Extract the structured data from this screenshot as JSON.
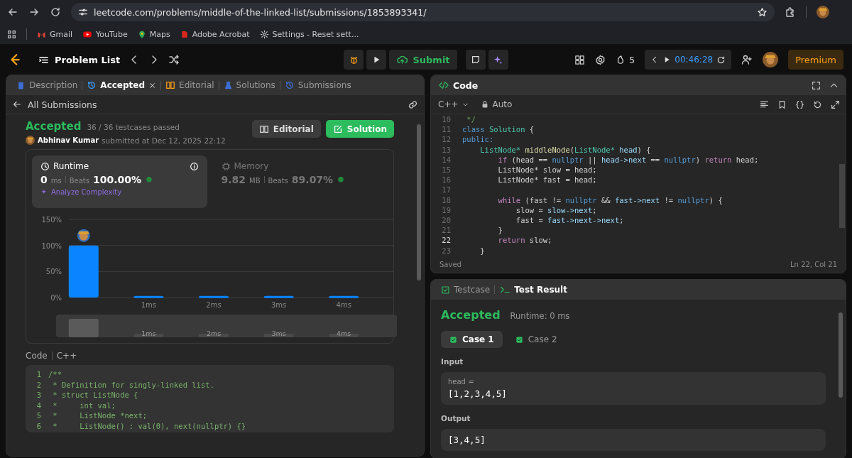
{
  "browser": {
    "url": "leetcode.com/problems/middle-of-the-linked-list/submissions/1853893341/",
    "bookmarks": [
      {
        "label": "Gmail",
        "kind": "gmail"
      },
      {
        "label": "YouTube",
        "kind": "youtube"
      },
      {
        "label": "Maps",
        "kind": "maps"
      },
      {
        "label": "Adobe Acrobat",
        "kind": "acrobat"
      },
      {
        "label": "Settings - Reset sett...",
        "kind": "settings"
      }
    ]
  },
  "nav": {
    "title": "Problem List",
    "submit": "Submit",
    "streak": "5",
    "timer": "00:46:28",
    "premium": "Premium"
  },
  "left_panel": {
    "tabs": [
      {
        "label": "Description",
        "kind": "description",
        "selected": false
      },
      {
        "label": "Accepted",
        "kind": "accepted",
        "selected": true
      },
      {
        "label": "Editorial",
        "kind": "editorial",
        "selected": false
      },
      {
        "label": "Solutions",
        "kind": "solutions",
        "selected": false
      },
      {
        "label": "Submissions",
        "kind": "submissions",
        "selected": false
      }
    ],
    "back_link": "All Submissions",
    "status": "Accepted",
    "testcases": "36 / 36 testcases passed",
    "author": "Abhinav Kumar",
    "submitted": "submitted at Dec 12, 2025 22:12",
    "buttons": [
      {
        "label": "Editorial",
        "kind": "editorial"
      },
      {
        "label": "Solution",
        "kind": "solution"
      }
    ],
    "stats": [
      {
        "kind": "runtime",
        "label": "Runtime",
        "value": "0",
        "unit": "ms",
        "beats_label": "Beats",
        "beats": "100.00%",
        "selected": true,
        "analyze": "Analyze Complexity"
      },
      {
        "kind": "memory",
        "label": "Memory",
        "value": "9.82",
        "unit": "MB",
        "beats_label": "Beats",
        "beats": "89.07%",
        "selected": false
      }
    ],
    "chart_data": {
      "type": "bar",
      "categories": [
        null,
        "1ms",
        "2ms",
        "3ms",
        "4ms"
      ],
      "values": [
        100,
        3,
        3,
        3,
        3
      ],
      "ylim": [
        0,
        150
      ],
      "yticks": [
        {
          "value": 0,
          "label": "0%"
        },
        {
          "value": 50,
          "label": "50%"
        },
        {
          "value": 100,
          "label": "100%"
        },
        {
          "value": 150,
          "label": "150%"
        }
      ]
    },
    "overview_labels": [
      "1ms",
      "2ms",
      "3ms",
      "4ms"
    ],
    "code_label": "Code",
    "language": "C++",
    "code": [
      {
        "n": "1",
        "text": "/**"
      },
      {
        "n": "2",
        "text": " * Definition for singly-linked list."
      },
      {
        "n": "3",
        "text": " * struct ListNode {"
      },
      {
        "n": "4",
        "text": " *     int val;"
      },
      {
        "n": "5",
        "text": " *     ListNode *next;"
      },
      {
        "n": "6",
        "text": " *     ListNode() : val(0), next(nullptr) {}"
      }
    ]
  },
  "code_panel": {
    "title": "Code",
    "language": "C++",
    "mode": "Auto",
    "lines": [
      {
        "n": "10",
        "selected": false,
        "tokens": [
          {
            "text": " */",
            "kind": "comment"
          }
        ]
      },
      {
        "n": "11",
        "selected": false,
        "tokens": [
          {
            "text": "class ",
            "kind": "keyword"
          },
          {
            "text": "Solution",
            "kind": "type"
          },
          {
            "text": " {",
            "kind": "plain"
          }
        ]
      },
      {
        "n": "12",
        "selected": false,
        "tokens": [
          {
            "text": "public:",
            "kind": "keyword"
          }
        ]
      },
      {
        "n": "13",
        "selected": false,
        "tokens": [
          {
            "text": "    ListNode*",
            "kind": "type"
          },
          {
            "text": " middleNode",
            "kind": "function"
          },
          {
            "text": "(",
            "kind": "plain"
          },
          {
            "text": "ListNode*",
            "kind": "type"
          },
          {
            "text": " head",
            "kind": "variable"
          },
          {
            "text": ") {",
            "kind": "plain"
          }
        ]
      },
      {
        "n": "14",
        "selected": false,
        "tokens": [
          {
            "text": "        if",
            "kind": "control"
          },
          {
            "text": " (head == ",
            "kind": "plain"
          },
          {
            "text": "nullptr",
            "kind": "keyword"
          },
          {
            "text": " || ",
            "kind": "plain"
          },
          {
            "text": "head->next",
            "kind": "variable"
          },
          {
            "text": " == ",
            "kind": "plain"
          },
          {
            "text": "nullptr",
            "kind": "keyword"
          },
          {
            "text": ") ",
            "kind": "plain"
          },
          {
            "text": "return",
            "kind": "control"
          },
          {
            "text": " head;",
            "kind": "plain"
          }
        ]
      },
      {
        "n": "15",
        "selected": false,
        "tokens": [
          {
            "text": "        ListNode* slow = head;",
            "kind": "plain"
          }
        ]
      },
      {
        "n": "16",
        "selected": false,
        "tokens": [
          {
            "text": "        ListNode* fast = head;",
            "kind": "plain"
          }
        ]
      },
      {
        "n": "17",
        "selected": false
      },
      {
        "n": "18",
        "selected": false,
        "tokens": [
          {
            "text": "        while",
            "kind": "control"
          },
          {
            "text": " (fast != ",
            "kind": "plain"
          },
          {
            "text": "nullptr",
            "kind": "keyword"
          },
          {
            "text": " && ",
            "kind": "plain"
          },
          {
            "text": "fast->next",
            "kind": "variable"
          },
          {
            "text": " != ",
            "kind": "plain"
          },
          {
            "text": "nullptr",
            "kind": "keyword"
          },
          {
            "text": ") {",
            "kind": "plain"
          }
        ]
      },
      {
        "n": "19",
        "selected": false,
        "tokens": [
          {
            "text": "            slow = ",
            "kind": "plain"
          },
          {
            "text": "slow->next",
            "kind": "variable"
          },
          {
            "text": ";",
            "kind": "plain"
          }
        ]
      },
      {
        "n": "20",
        "selected": false,
        "tokens": [
          {
            "text": "            fast = ",
            "kind": "plain"
          },
          {
            "text": "fast->next->next",
            "kind": "variable"
          },
          {
            "text": ";",
            "kind": "plain"
          }
        ]
      },
      {
        "n": "21",
        "selected": false,
        "tokens": [
          {
            "text": "        }",
            "kind": "plain"
          }
        ]
      },
      {
        "n": "22",
        "selected": true,
        "tokens": [
          {
            "text": "        return",
            "kind": "control"
          },
          {
            "text": " slow;",
            "kind": "plain"
          }
        ]
      },
      {
        "n": "23",
        "selected": false,
        "tokens": [
          {
            "text": "    }",
            "kind": "plain"
          }
        ]
      }
    ],
    "status": "Saved",
    "cursor": "Ln 22, Col 21"
  },
  "result_panel": {
    "tabs": [
      {
        "label": "Testcase",
        "kind": "testcase",
        "selected": false
      },
      {
        "label": "Test Result",
        "kind": "result",
        "selected": true
      }
    ],
    "status": "Accepted",
    "runtime": "Runtime: 0 ms",
    "cases": [
      {
        "label": "Case 1",
        "selected": true
      },
      {
        "label": "Case 2",
        "selected": false
      }
    ],
    "input_label": "Input",
    "inputs": [
      {
        "name": "head =",
        "value": "[1,2,3,4,5]"
      }
    ],
    "output_label": "Output",
    "output": "[3,4,5]"
  }
}
